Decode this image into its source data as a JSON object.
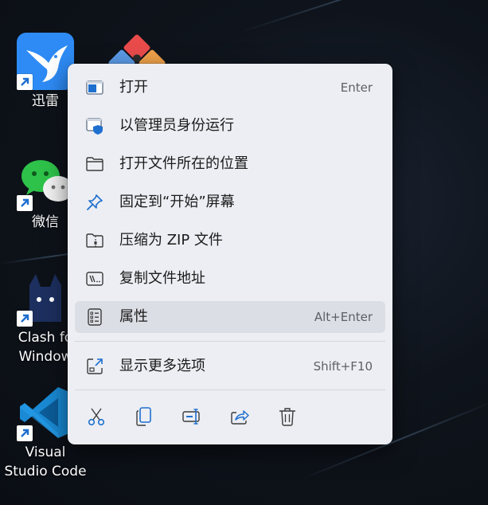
{
  "desktop": {
    "icons": [
      {
        "label": "迅雷"
      },
      {
        "label": "微信"
      },
      {
        "label": "Clash fo\nWindow"
      },
      {
        "label": "Visual\nStudio Code"
      }
    ]
  },
  "menu": {
    "items": [
      {
        "label": "打开",
        "accelerator": "Enter",
        "icon": "open-window-icon"
      },
      {
        "label": "以管理员身份运行",
        "accelerator": "",
        "icon": "run-as-admin-shield-icon"
      },
      {
        "label": "打开文件所在的位置",
        "accelerator": "",
        "icon": "folder-icon"
      },
      {
        "label": "固定到“开始”屏幕",
        "accelerator": "",
        "icon": "pin-icon"
      },
      {
        "label": "压缩为 ZIP 文件",
        "accelerator": "",
        "icon": "zip-folder-icon"
      },
      {
        "label": "复制文件地址",
        "accelerator": "",
        "icon": "copy-path-icon"
      },
      {
        "label": "属性",
        "accelerator": "Alt+Enter",
        "icon": "properties-icon"
      },
      {
        "label": "显示更多选项",
        "accelerator": "Shift+F10",
        "icon": "more-options-icon"
      }
    ],
    "hovered_item": "属性",
    "toolbar": [
      "cut-icon",
      "copy-icon",
      "rename-icon",
      "share-icon",
      "delete-icon"
    ]
  },
  "colors": {
    "accent": "#1f6fcf",
    "menu_background": "#eceef3",
    "hover": "#dcdee5"
  }
}
